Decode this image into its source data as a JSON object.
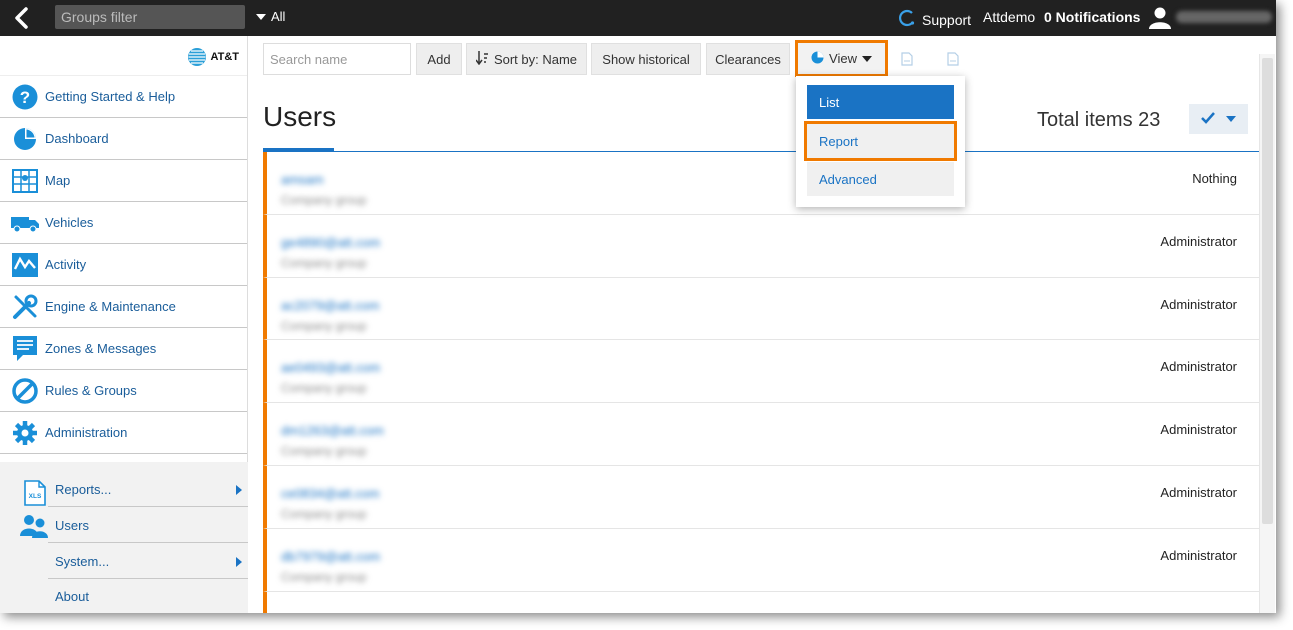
{
  "topbar": {
    "groups_filter_placeholder": "Groups filter",
    "groups_dropdown_value": "All",
    "support_label": "Support",
    "user_name": "Attdemo",
    "notifications_label": "0 Notifications"
  },
  "brand": {
    "logo_text": "AT&T"
  },
  "sidebar": {
    "items": [
      {
        "label": "Getting Started & Help",
        "icon": "help-icon"
      },
      {
        "label": "Dashboard",
        "icon": "pie-chart-icon"
      },
      {
        "label": "Map",
        "icon": "map-icon"
      },
      {
        "label": "Vehicles",
        "icon": "truck-icon"
      },
      {
        "label": "Activity",
        "icon": "activity-icon"
      },
      {
        "label": "Engine & Maintenance",
        "icon": "wrench-icon"
      },
      {
        "label": "Zones & Messages",
        "icon": "message-icon"
      },
      {
        "label": "Rules & Groups",
        "icon": "rules-icon"
      },
      {
        "label": "Administration",
        "icon": "gear-icon"
      }
    ],
    "sub_items": [
      {
        "label": "Reports...",
        "icon": "xls-icon",
        "has_submenu": true
      },
      {
        "label": "Users",
        "icon": "users-icon",
        "has_submenu": false
      },
      {
        "label": "System...",
        "has_submenu": true
      },
      {
        "label": "About",
        "has_submenu": false
      }
    ]
  },
  "toolbar": {
    "search_placeholder": "Search name",
    "add_label": "Add",
    "sort_label": "Sort by: Name",
    "historical_label": "Show historical",
    "clearances_label": "Clearances",
    "view_label": "View"
  },
  "view_menu": {
    "options": [
      "List",
      "Report",
      "Advanced"
    ],
    "selected": "List",
    "highlighted": "Report"
  },
  "main": {
    "title": "Users",
    "total_items": "Total items 23"
  },
  "rows": [
    {
      "name": "amsam",
      "group": "Company group",
      "role": "Nothing"
    },
    {
      "name": "ge4890@att.com",
      "group": "Company group",
      "role": "Administrator"
    },
    {
      "name": "ac2079@att.com",
      "group": "Company group",
      "role": "Administrator"
    },
    {
      "name": "ae0493@att.com",
      "group": "Company group",
      "role": "Administrator"
    },
    {
      "name": "dm1263@att.com",
      "group": "Company group",
      "role": "Administrator"
    },
    {
      "name": "ce0834@att.com",
      "group": "Company group",
      "role": "Administrator"
    },
    {
      "name": "db7979@att.com",
      "group": "Company group",
      "role": "Administrator"
    }
  ],
  "colors": {
    "accent": "#1a73c4",
    "highlight": "#f07a00",
    "topbar": "#212121"
  }
}
